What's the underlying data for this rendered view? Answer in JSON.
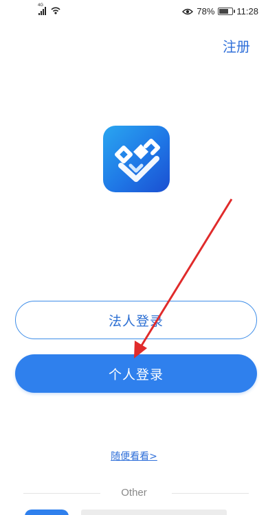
{
  "status_bar": {
    "network": "4G",
    "battery_percent": "78%",
    "battery_level": 0.78,
    "time": "11:28"
  },
  "header": {
    "register_label": "注册"
  },
  "logo": {
    "icon": "app-logo-heart-chevron"
  },
  "buttons": {
    "corporate_login": "法人登录",
    "personal_login": "个人登录"
  },
  "browse_link": "随便看看>",
  "divider_label": "Other",
  "colors": {
    "accent": "#2f80ed",
    "link": "#2f6fd9",
    "arrow_annotation": "#e02b2b"
  }
}
